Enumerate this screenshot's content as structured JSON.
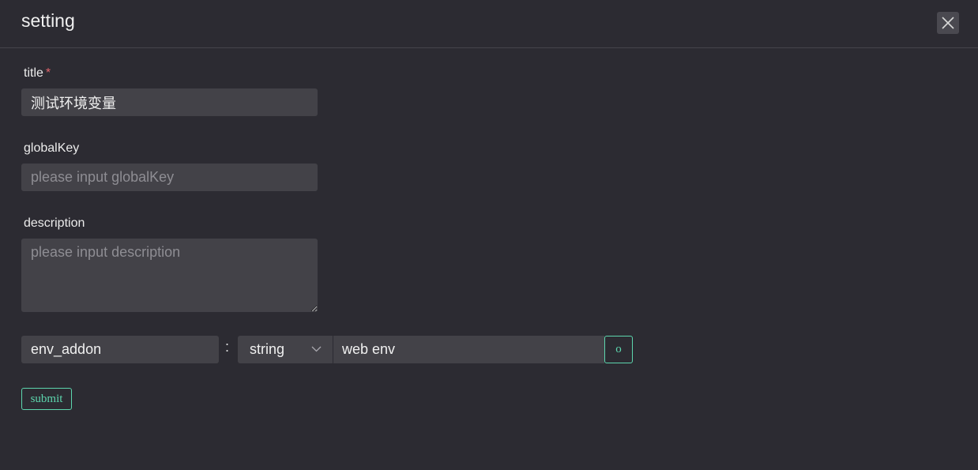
{
  "dialog": {
    "title": "setting",
    "close_icon": "close-icon"
  },
  "form": {
    "title_field": {
      "label": "title",
      "required_mark": "*",
      "value": "测试环境变量",
      "placeholder": ""
    },
    "global_key_field": {
      "label": "globalKey",
      "value": "",
      "placeholder": "please input globalKey"
    },
    "description_field": {
      "label": "description",
      "value": "",
      "placeholder": "please input description"
    },
    "env_row": {
      "key": "env_addon",
      "separator": ":",
      "type_selected": "string",
      "type_icon": "chevron-down-icon",
      "value": "web env",
      "action_label": "o"
    },
    "submit_label": "submit"
  },
  "colors": {
    "background": "#2c2b32",
    "input_bg": "#434248",
    "accent": "#5dd6ae",
    "required": "#e0646c"
  }
}
